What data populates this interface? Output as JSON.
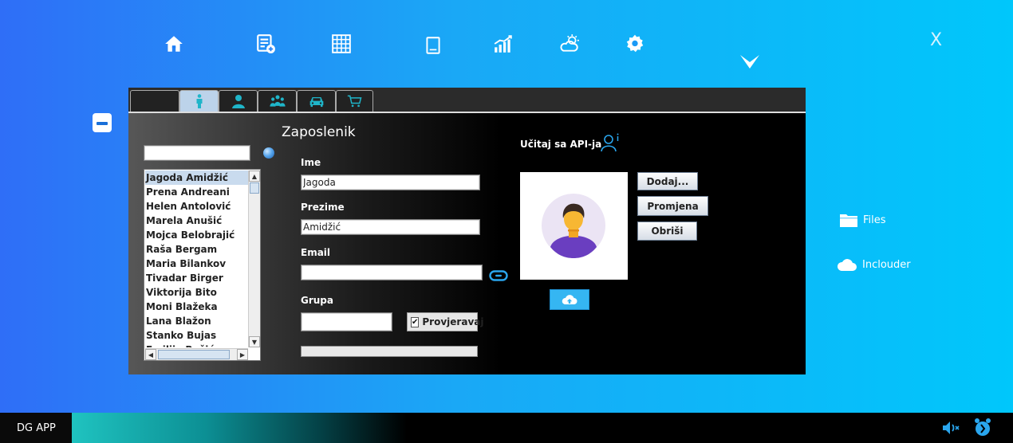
{
  "window": {
    "close_label": "X"
  },
  "side_links": {
    "files": "Files",
    "incloud": "Inclouder"
  },
  "tabs": [
    {
      "name": "tab-blank"
    },
    {
      "name": "tab-employee-person",
      "icon": "person-icon",
      "active": true
    },
    {
      "name": "tab-user",
      "icon": "user-silhouette-icon"
    },
    {
      "name": "tab-group",
      "icon": "group-icon"
    },
    {
      "name": "tab-car",
      "icon": "car-icon"
    },
    {
      "name": "tab-cart",
      "icon": "cart-icon"
    }
  ],
  "form": {
    "title": "Zaposlenik",
    "search_value": "",
    "ime_label": "Ime",
    "ime_value": "Jagoda",
    "prezime_label": "Prezime",
    "prezime_value": "Amidžić",
    "email_label": "Email",
    "email_value": "",
    "grupa_label": "Grupa",
    "grupa_value": "",
    "checkbox_label": "Provjeravaj",
    "checkbox_checked": true,
    "api_label": "Učitaj sa API-ja",
    "btn_dodaj": "Dodaj...",
    "btn_promjena": "Promjena",
    "btn_obrisi": "Obriši"
  },
  "employees": [
    "Jagoda Amidžić",
    "Prena Andreani",
    "Helen Antolović",
    "Marela Anušić",
    "Mojca Belobrajić",
    "Raša Bergam",
    "Maria Bilankov",
    "Tivadar Birger",
    "Viktorija Bito",
    "Moni Blažeka",
    "Lana Blažon",
    "Stanko Bujas",
    "Emilija Bušić"
  ],
  "selected_employee": "Jagoda Amidžić",
  "colors": {
    "accent": "#1aa8f6",
    "upload_button": "#35b6f2",
    "taskbar_accent": "#1fc3c0"
  },
  "taskbar": {
    "app_label": "DG APP"
  }
}
